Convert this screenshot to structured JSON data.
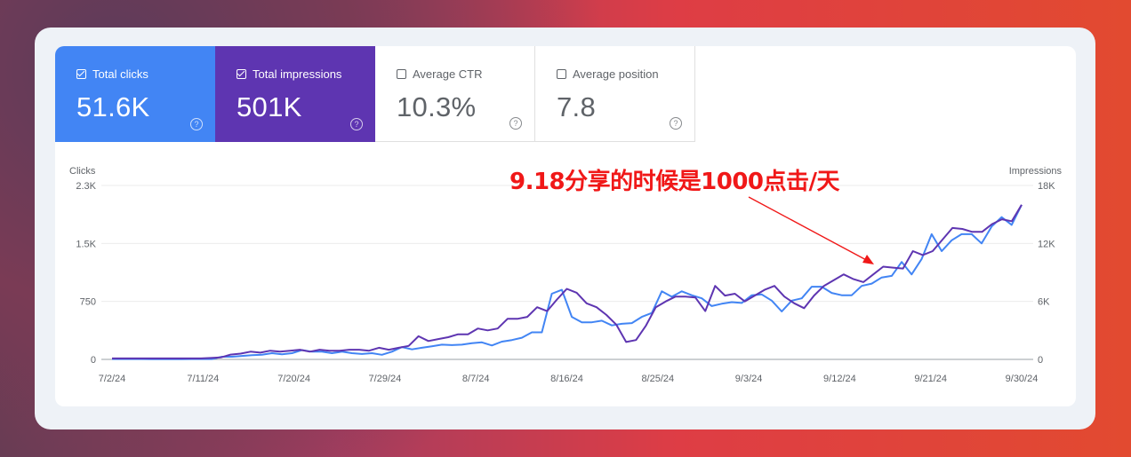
{
  "metrics": [
    {
      "label": "Total clicks",
      "value": "51.6K",
      "checked": true
    },
    {
      "label": "Total impressions",
      "value": "501K",
      "checked": true
    },
    {
      "label": "Average CTR",
      "value": "10.3%",
      "checked": false
    },
    {
      "label": "Average position",
      "value": "7.8",
      "checked": false
    }
  ],
  "help_glyph": "?",
  "annotation": "9.18分享的时候是1000点击/天",
  "colors": {
    "clicks": "#4285f4",
    "impressions": "#5e35b1",
    "annotation": "#f01818",
    "grid": "#ebebeb"
  },
  "chart_data": {
    "type": "line",
    "left_axis_label": "Clicks",
    "right_axis_label": "Impressions",
    "left_ylim": [
      0,
      2250
    ],
    "right_ylim": [
      0,
      18000
    ],
    "left_ticks": [
      "0",
      "750",
      "1.5K",
      "2.3K"
    ],
    "right_ticks": [
      "0",
      "6K",
      "12K",
      "18K"
    ],
    "x_ticks": [
      "7/2/24",
      "7/11/24",
      "7/20/24",
      "7/29/24",
      "8/7/24",
      "8/16/24",
      "8/25/24",
      "9/3/24",
      "9/12/24",
      "9/21/24",
      "9/30/24"
    ],
    "x_start": "7/2/24",
    "grid": true,
    "series": [
      {
        "name": "Total clicks",
        "axis": "left",
        "values": [
          5,
          5,
          5,
          5,
          4,
          4,
          4,
          4,
          5,
          5,
          5,
          35,
          35,
          45,
          55,
          60,
          80,
          65,
          80,
          120,
          100,
          100,
          80,
          100,
          80,
          70,
          80,
          60,
          100,
          160,
          130,
          150,
          170,
          190,
          185,
          190,
          210,
          220,
          180,
          230,
          250,
          280,
          350,
          350,
          850,
          900,
          550,
          480,
          480,
          500,
          440,
          460,
          470,
          550,
          600,
          880,
          810,
          880,
          830,
          790,
          690,
          720,
          740,
          730,
          830,
          840,
          760,
          620,
          760,
          790,
          940,
          940,
          860,
          830,
          830,
          950,
          980,
          1060,
          1080,
          1260,
          1100,
          1300,
          1620,
          1400,
          1540,
          1620,
          1620,
          1500,
          1720,
          1840,
          1740,
          2000
        ]
      },
      {
        "name": "Total impressions",
        "axis": "right",
        "values": [
          100,
          100,
          100,
          100,
          100,
          100,
          100,
          100,
          100,
          100,
          150,
          200,
          500,
          600,
          800,
          700,
          900,
          800,
          900,
          1000,
          800,
          1000,
          900,
          900,
          1000,
          1000,
          900,
          1200,
          1000,
          1200,
          1400,
          2400,
          1900,
          2100,
          2300,
          2600,
          2600,
          3200,
          3000,
          3200,
          4200,
          4200,
          4400,
          5400,
          5000,
          6200,
          7300,
          6900,
          5800,
          5400,
          4600,
          3600,
          1800,
          2000,
          3500,
          5400,
          6000,
          6500,
          6500,
          6400,
          5000,
          7600,
          6600,
          6800,
          6000,
          6600,
          7200,
          7600,
          6500,
          5800,
          5300,
          6600,
          7600,
          8200,
          8800,
          8300,
          8000,
          8800,
          9600,
          9500,
          9400,
          11200,
          10800,
          11200,
          12400,
          13600,
          13500,
          13200,
          13200,
          14000,
          14500,
          14300,
          16000
        ]
      }
    ]
  }
}
